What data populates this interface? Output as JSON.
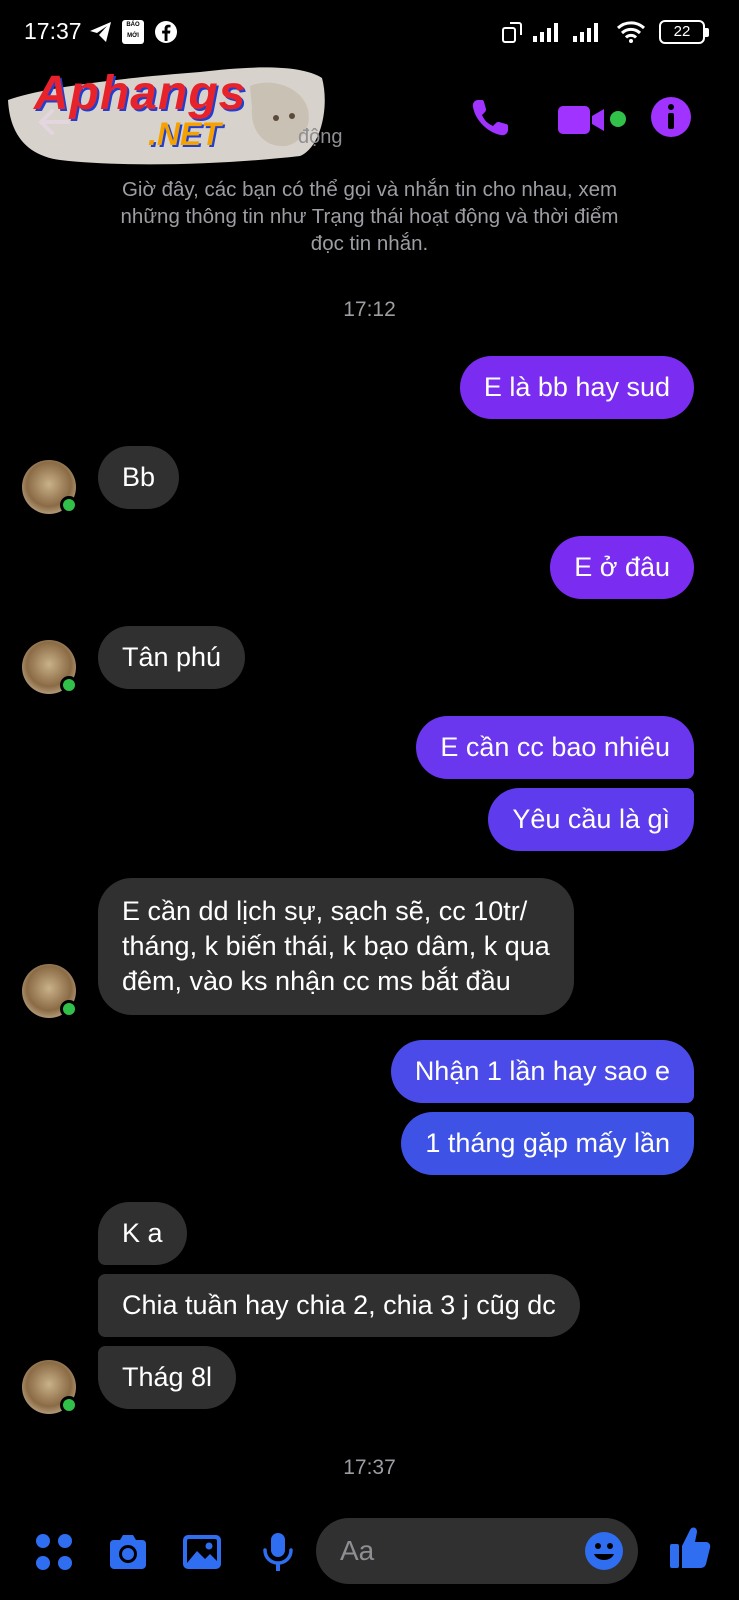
{
  "status_bar": {
    "time": "17:37",
    "icons": [
      "telegram-icon",
      "baomoi-icon",
      "facebook-icon",
      "rotate-icon",
      "signal-icon",
      "signal-icon",
      "wifi-icon"
    ],
    "bao_moi_label": "BÁO MỚI",
    "battery": "22"
  },
  "watermark": {
    "logo_text_1": "Aphangs",
    "logo_text_2": ".NET"
  },
  "header": {
    "status_fragment": "động",
    "accent_color": "#a033ff",
    "active_color": "#31c14b"
  },
  "notice": "Giờ đây, các bạn có thể gọi và nhắn tin cho nhau, xem những thông tin như Trạng thái hoạt động và thời điểm đọc tin nhắn.",
  "timestamps": [
    "17:12",
    "17:37"
  ],
  "messages": [
    {
      "dir": "out",
      "text": "E là bb hay sud",
      "color": "#7a2df0"
    },
    {
      "dir": "in",
      "text": "Bb"
    },
    {
      "dir": "out",
      "text": "E ở đâu",
      "color": "#7a2df0"
    },
    {
      "dir": "in",
      "text": "Tân phú"
    },
    {
      "dir": "out",
      "text": "E cần cc bao nhiêu",
      "color": "#6a36ee"
    },
    {
      "dir": "out",
      "text": "Yêu cầu là gì",
      "color": "#5e3bec"
    },
    {
      "dir": "in",
      "lines": [
        "E cần dd lịch sự, sạch sẽ, cc 10tr/",
        "tháng, k biến thái, k bạo dâm, k qua",
        "đêm, vào ks nhận cc ms bắt đầu"
      ]
    },
    {
      "dir": "out",
      "text": "Nhận 1 lần hay sao e",
      "color": "#4a4be8"
    },
    {
      "dir": "out",
      "text": "1 tháng gặp mấy lần",
      "color": "#3f52e6"
    },
    {
      "dir": "in",
      "text": "K a"
    },
    {
      "dir": "in",
      "text": "Chia tuần hay chia 2, chia 3 j cũg dc"
    },
    {
      "dir": "in",
      "text": "Thág 8l"
    }
  ],
  "composer": {
    "placeholder": "Aa",
    "icons": [
      "apps-icon",
      "camera-icon",
      "gallery-icon",
      "mic-icon",
      "emoji-icon",
      "like-icon"
    ],
    "icon_color": "#2f6ef0"
  }
}
